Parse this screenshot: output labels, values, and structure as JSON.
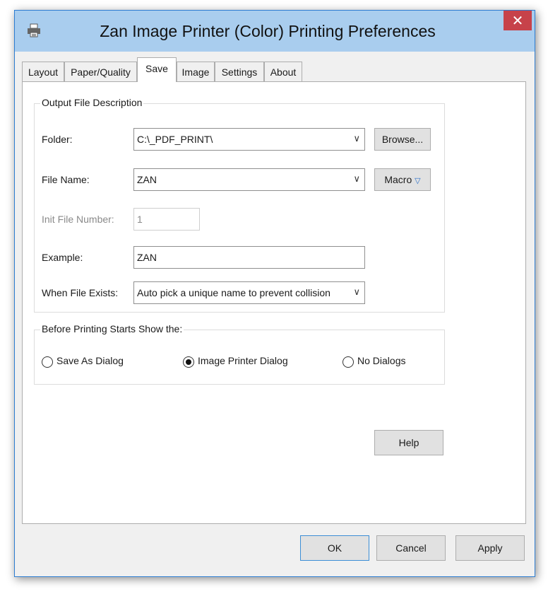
{
  "window": {
    "title": "Zan Image Printer (Color) Printing Preferences",
    "close_glyph": "✕"
  },
  "tabs": [
    {
      "label": "Layout"
    },
    {
      "label": "Paper/Quality"
    },
    {
      "label": "Save"
    },
    {
      "label": "Image"
    },
    {
      "label": "Settings"
    },
    {
      "label": "About"
    }
  ],
  "output_group": {
    "legend": "Output File Description",
    "folder_label": "Folder:",
    "folder_value": "C:\\_PDF_PRINT\\",
    "browse_label": "Browse...",
    "filename_label": "File Name:",
    "filename_value": "ZAN",
    "macro_label": "Macro",
    "macro_arrow": "▽",
    "init_label": "Init File Number:",
    "init_value": "1",
    "example_label": "Example:",
    "example_value": "ZAN",
    "exists_label": "When File Exists:",
    "exists_value": "Auto pick a unique name to prevent collision",
    "dropdown_glyph": "∨"
  },
  "before_group": {
    "legend": "Before Printing Starts Show the:",
    "options": [
      {
        "label": "Save As Dialog",
        "selected": false
      },
      {
        "label": "Image Printer Dialog",
        "selected": true
      },
      {
        "label": "No Dialogs",
        "selected": false
      }
    ]
  },
  "buttons": {
    "help": "Help",
    "ok": "OK",
    "cancel": "Cancel",
    "apply": "Apply"
  },
  "colors": {
    "titlebar": "#a9cdee",
    "close": "#c7424a",
    "accent_border": "#3c8ed6"
  },
  "icons": {
    "title_icon": "printer-icon"
  }
}
